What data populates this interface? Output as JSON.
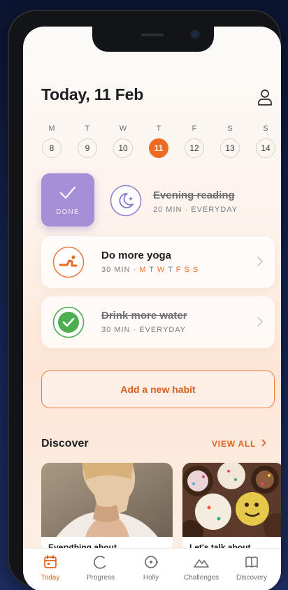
{
  "header": {
    "title": "Today, 11 Feb"
  },
  "week": [
    {
      "letter": "M",
      "num": "8"
    },
    {
      "letter": "T",
      "num": "9"
    },
    {
      "letter": "W",
      "num": "10"
    },
    {
      "letter": "T",
      "num": "11",
      "active": true
    },
    {
      "letter": "F",
      "num": "12"
    },
    {
      "letter": "S",
      "num": "13"
    },
    {
      "letter": "S",
      "num": "14"
    }
  ],
  "done_card": {
    "label": "DONE"
  },
  "habits": [
    {
      "name": "Evening reading",
      "sub": "20 MIN · EVERYDAY",
      "completed": true,
      "icon": "moon-stars-icon"
    },
    {
      "name": "Do more yoga",
      "sub_prefix": "30 MIN · ",
      "days": [
        "M",
        "T",
        "W",
        "T",
        "F",
        "S",
        "S"
      ],
      "active_days": [
        true,
        false,
        true,
        false,
        true,
        true,
        true
      ],
      "icon": "yoga-icon"
    },
    {
      "name": "Drink more water",
      "sub": "30 MIN · EVERYDAY",
      "completed": true,
      "icon": "check-circle-icon"
    }
  ],
  "add_habit": {
    "label": "Add a new habit"
  },
  "discover": {
    "title": "Discover",
    "view_all": "VIEW ALL",
    "cards": [
      {
        "caption": "Everything about"
      },
      {
        "caption": "Let's talk about"
      }
    ]
  },
  "tabs": [
    {
      "label": "Today",
      "icon": "calendar-icon",
      "active": true
    },
    {
      "label": "Progress",
      "icon": "progress-ring-icon"
    },
    {
      "label": "Holly",
      "icon": "holly-icon"
    },
    {
      "label": "Challenges",
      "icon": "mountain-icon"
    },
    {
      "label": "Discovery",
      "icon": "book-icon"
    }
  ],
  "colors": {
    "accent": "#ef6a23",
    "done_purple": "#a58fd6",
    "water_green": "#4caf50"
  }
}
